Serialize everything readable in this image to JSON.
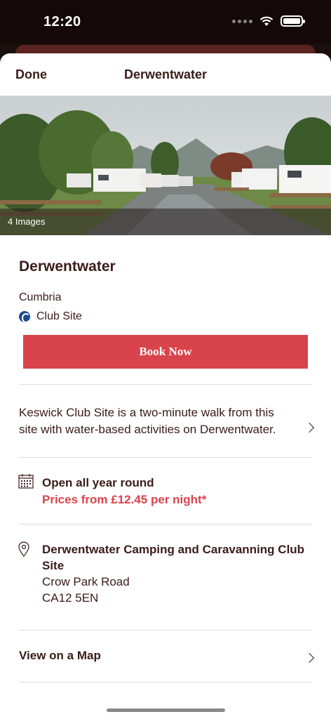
{
  "status": {
    "time": "12:20"
  },
  "nav": {
    "done_label": "Done",
    "title": "Derwentwater"
  },
  "gallery": {
    "image_count_label": "4 Images"
  },
  "site": {
    "name": "Derwentwater",
    "region": "Cumbria",
    "type": "Club Site",
    "book_label": "Book Now",
    "description": "Keswick Club Site is a two-minute walk from this site with water-based activities on Derwentwater."
  },
  "availability": {
    "open": "Open all year round",
    "price": "Prices from £12.45 per night*"
  },
  "address": {
    "name": "Derwentwater Camping and Caravanning Club Site",
    "line1": "Crow Park Road",
    "postcode": "CA12 5EN"
  },
  "map": {
    "label": "View on a Map"
  },
  "colors": {
    "accent": "#d9434b",
    "text": "#3a1c19",
    "club_blue": "#1f4a8f"
  },
  "icons": [
    "wifi-icon",
    "battery-icon",
    "calendar-icon",
    "location-pin-icon",
    "chevron-right-icon",
    "club-site-icon"
  ]
}
